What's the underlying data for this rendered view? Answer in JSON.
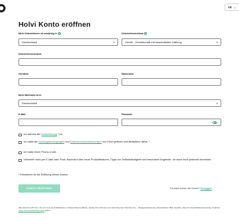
{
  "header": {
    "language": "DE",
    "title": "Holvi Konto eröffnen"
  },
  "form": {
    "country_label": "Mein Unternehmen ist ansässig in",
    "country_value": "Deutschland",
    "company_type_label": "Unternehmensform",
    "company_type_value": "GmbH - Gesellschaft mit beschränkter Haftung",
    "company_name_label": "Unternehmensname",
    "company_name_value": "",
    "firstname_label": "Vorname",
    "firstname_value": "",
    "lastname_label": "Nachname",
    "lastname_value": "",
    "residence_label": "Mein Wohnsitz ist in",
    "residence_value": "Deutschland",
    "email_label": "E-Mail",
    "email_value": "",
    "password_label": "Passwort",
    "password_value": ""
  },
  "consents": {
    "c1_pre": "Ich stimme der",
    "c1_link": "Kontoführung",
    "c1_post": "* zu.",
    "c2_pre": "Ich habe die",
    "c2_link1": "Nutzungsbedingungen",
    "c2_mid": "und",
    "c2_link2": "Datenschutzbestimmungen",
    "c2_post": "von Holvi gelesen und akzeptiere diese.",
    "c2_star": "*",
    "c3": "Ich habe einen Promo-Code.",
    "c4": "Informiert mich per E-Mail oder Push-Nachricht über neue Produktfeatures, Tipps zur Selbstständigkeit und besondere Angebote. Ich kann mich jederzeit abmelden."
  },
  "required_note": "* Erforderlich für die Eröffnung deines Kontos",
  "submit_label": "KONTO ERÖFFNEN",
  "have_account": {
    "text": "Du hast schon ein Konto?",
    "link": "Einloggen"
  },
  "footer": {
    "text": "Alle Holvi-Kund*innen, die ein neue Geschäftskonto in Deutschland eröffnen, werden Kund*innen von Holvi Payment Services Oy – Zweigniederlassung Deutschland. Bitte beachte, dass Ihr Geschäftskontovertrag zunächst",
    "link": "unter Nutzungsbedingungen",
    "post": "gelten."
  },
  "colors": {
    "accent": "#2f9e6d",
    "button_bg": "#8fdcc0"
  }
}
